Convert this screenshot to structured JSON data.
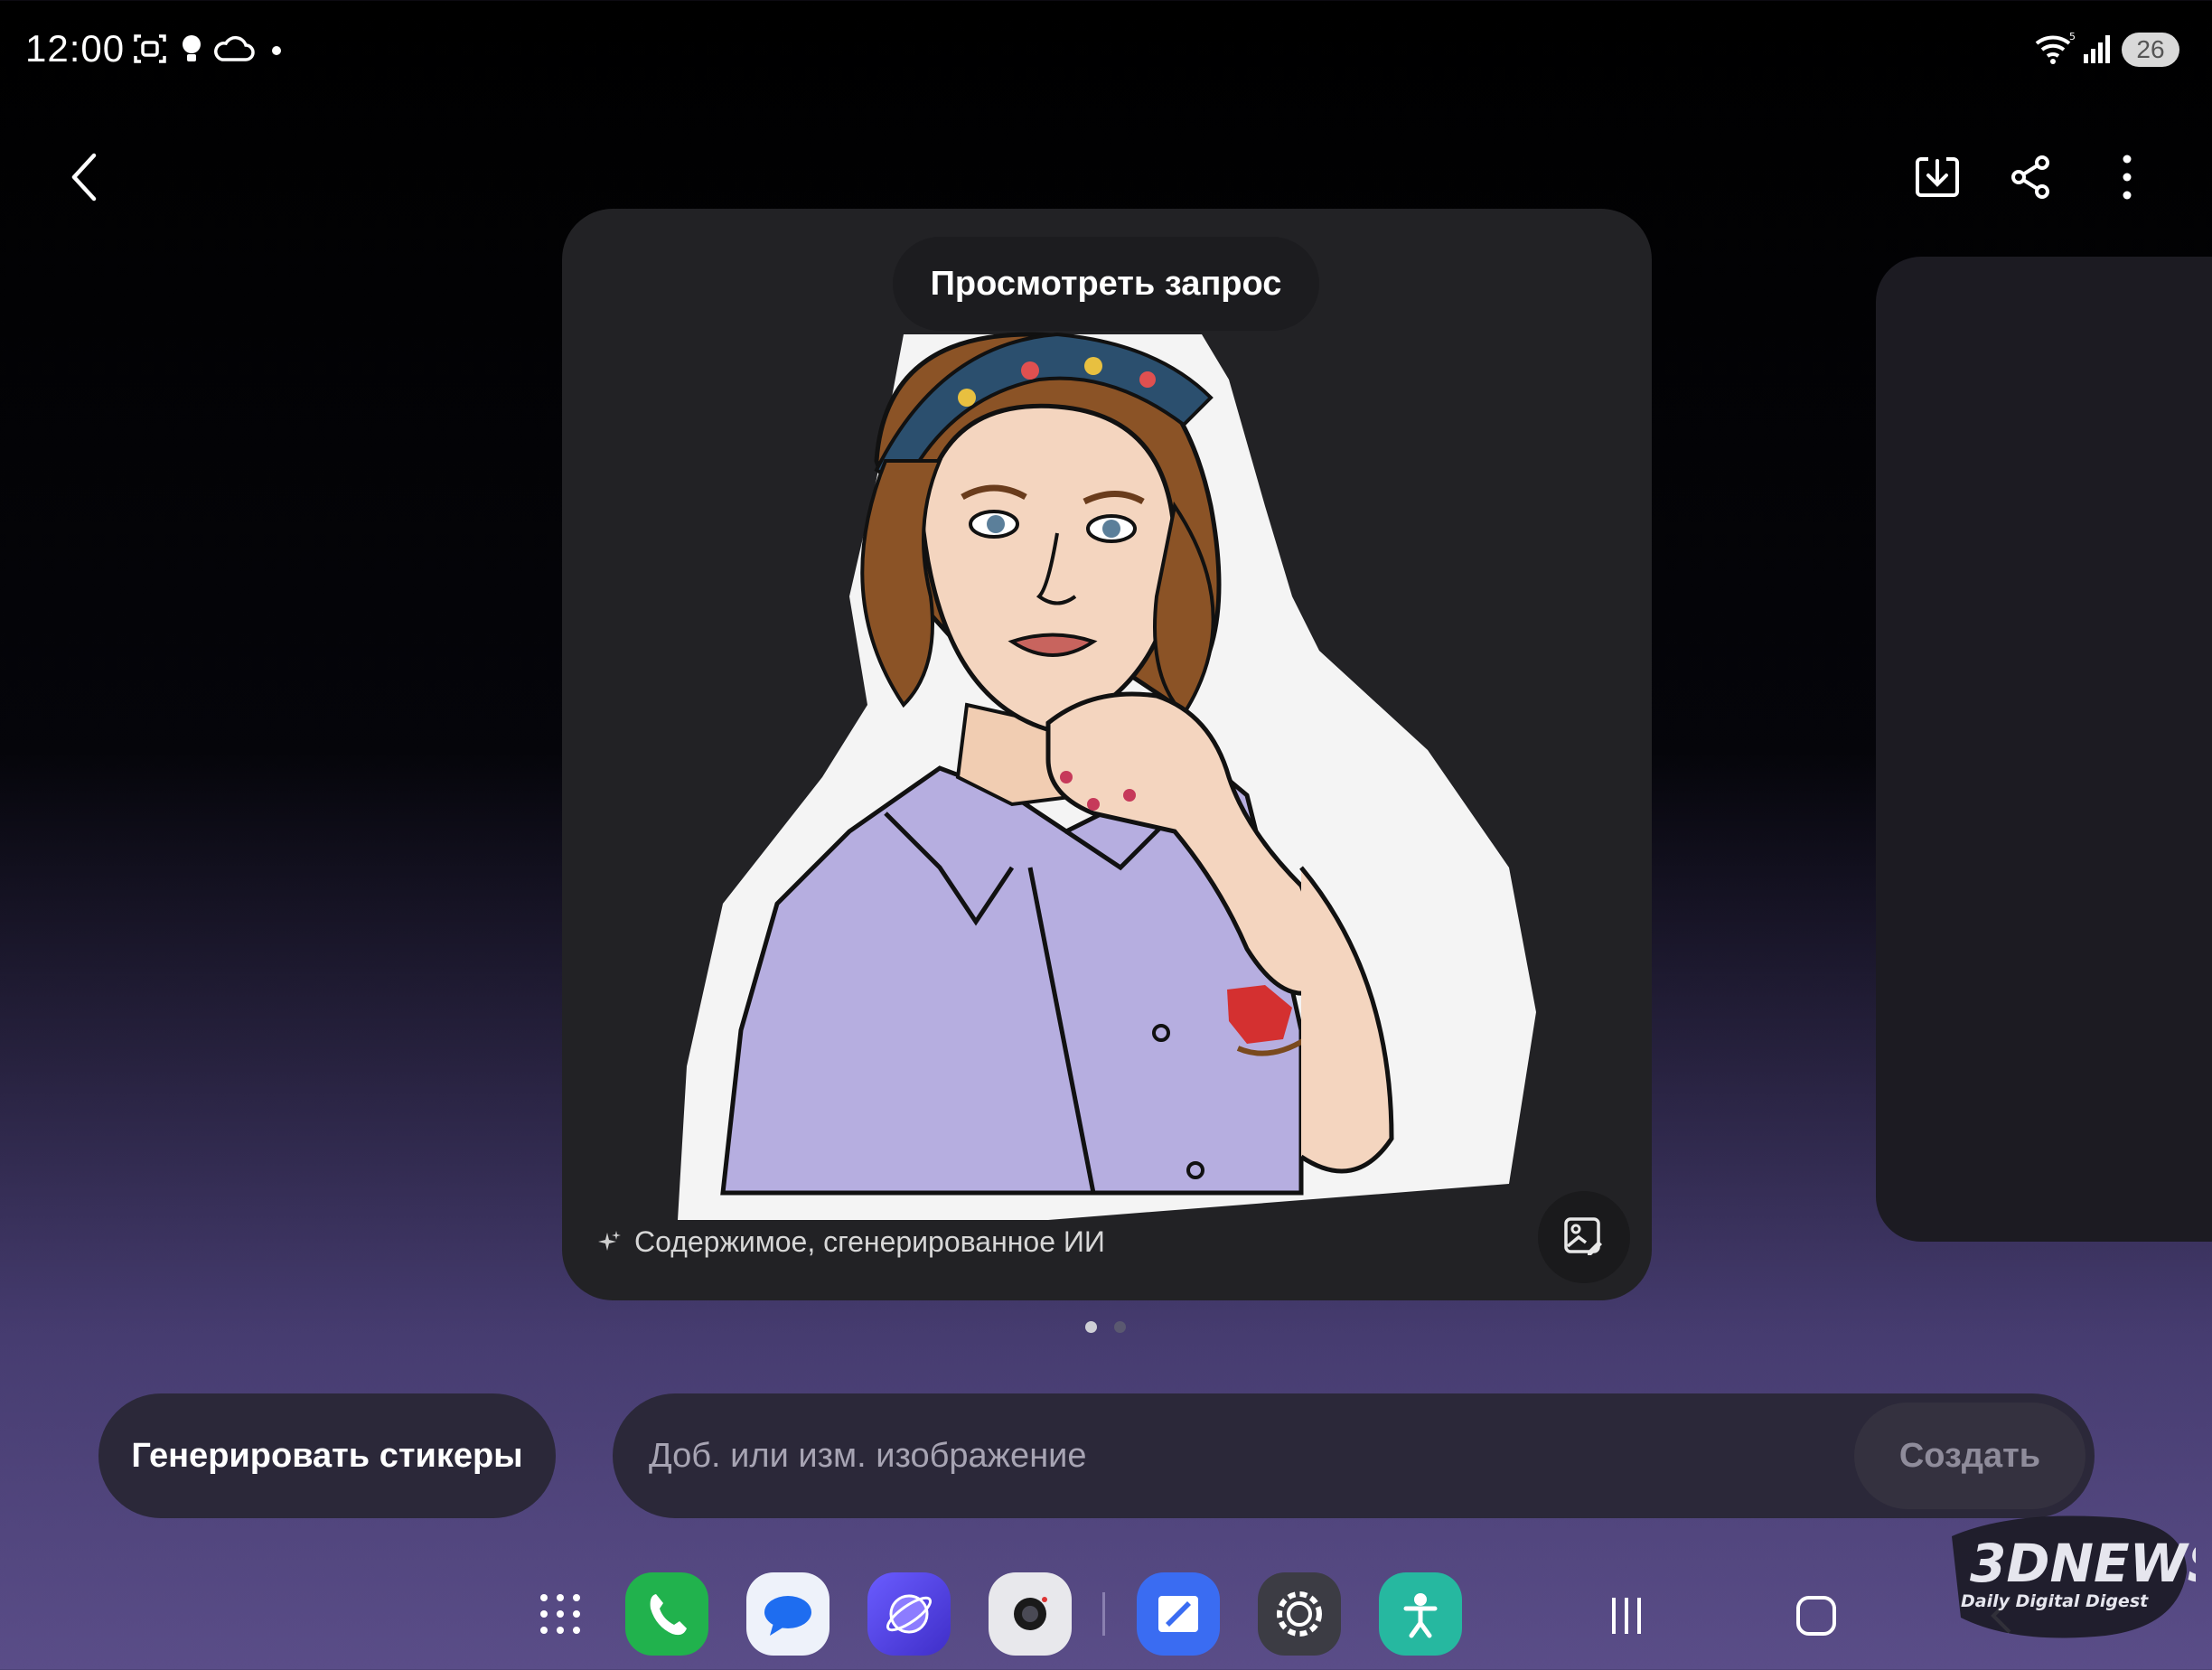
{
  "status_bar": {
    "time": "12:00",
    "left_icons": [
      "screenshot-icon",
      "bulb-icon",
      "cloud-icon",
      "dot-icon"
    ],
    "right_icons": [
      "wifi-icon",
      "signal-icon"
    ],
    "battery": "26"
  },
  "top_bar": {
    "icons": [
      "back-icon",
      "download-icon",
      "share-icon",
      "more-icon"
    ]
  },
  "card": {
    "view_prompt_label": "Просмотреть запрос",
    "ai_label": "Содержимое, сгенерированное ИИ",
    "sticker_subject": "sticker-illustration",
    "edit_icon": "image-edit-icon"
  },
  "pager": {
    "count": 2,
    "active": 1
  },
  "bottom": {
    "generate_label": "Генерировать стикеры",
    "prompt_placeholder": "Доб. или изм. изображение",
    "create_label": "Создать"
  },
  "dock": {
    "apps": [
      "apps-grid-icon",
      "phone-icon",
      "messages-icon",
      "internet-icon",
      "camera-icon",
      "notes-icon",
      "settings-icon",
      "accessibility-icon"
    ],
    "nav": [
      "recents-icon",
      "home-icon",
      "back-nav-icon"
    ]
  },
  "watermark": {
    "brand": "3DNEWS",
    "tagline": "Daily Digital Digest"
  },
  "colors": {
    "card_bg": "#222225",
    "pill_bg": "#2b2839",
    "bg_bottom": "#5a4d88"
  }
}
